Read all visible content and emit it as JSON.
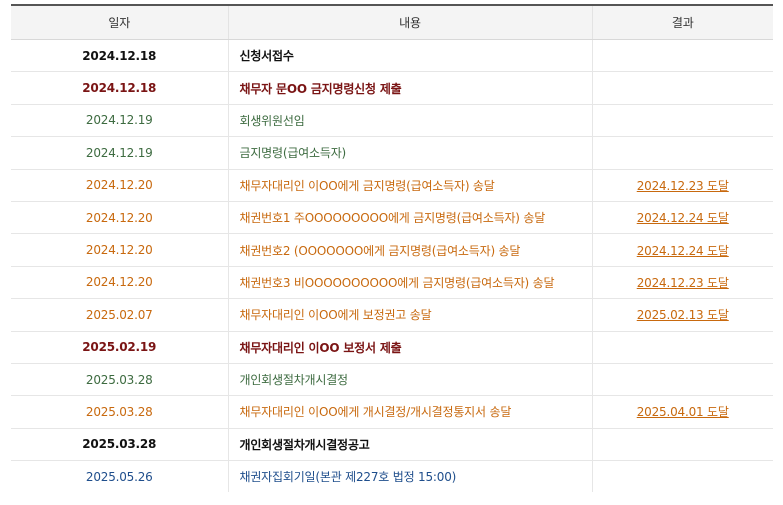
{
  "headers": {
    "date": "일자",
    "content": "내용",
    "result": "결과"
  },
  "colors": {
    "black": "#111111",
    "maroon": "#7a1414",
    "green": "#3d6b40",
    "orange": "#c8690e",
    "blue": "#1f4e8c"
  },
  "rows": [
    {
      "date": "2024.12.18",
      "content": "신청서접수",
      "result": "",
      "color": "#111111",
      "bold": true
    },
    {
      "date": "2024.12.18",
      "content": "채무자 문OO 금지명령신청 제출",
      "result": "",
      "color": "#7a1414",
      "bold": true
    },
    {
      "date": "2024.12.19",
      "content": "회생위원선임",
      "result": "",
      "color": "#3d6b40",
      "bold": false
    },
    {
      "date": "2024.12.19",
      "content": "금지명령(급여소득자)",
      "result": "",
      "color": "#3d6b40",
      "bold": false
    },
    {
      "date": "2024.12.20",
      "content": "채무자대리인 이OO에게 금지명령(급여소득자) 송달",
      "result": "2024.12.23 도달",
      "color": "#c8690e",
      "bold": false
    },
    {
      "date": "2024.12.20",
      "content": "채권번호1 주OOOOOOOOO에게 금지명령(급여소득자) 송달",
      "result": "2024.12.24 도달",
      "color": "#c8690e",
      "bold": false
    },
    {
      "date": "2024.12.20",
      "content": "채권번호2 (OOOOOOO에게 금지명령(급여소득자) 송달",
      "result": "2024.12.24 도달",
      "color": "#c8690e",
      "bold": false
    },
    {
      "date": "2024.12.20",
      "content": "채권번호3 비OOOOOOOOOO에게 금지명령(급여소득자) 송달",
      "result": "2024.12.23 도달",
      "color": "#c8690e",
      "bold": false
    },
    {
      "date": "2025.02.07",
      "content": "채무자대리인 이OO에게 보정권고 송달",
      "result": "2025.02.13 도달",
      "color": "#c8690e",
      "bold": false
    },
    {
      "date": "2025.02.19",
      "content": "채무자대리인 이OO 보정서 제출",
      "result": "",
      "color": "#7a1414",
      "bold": true
    },
    {
      "date": "2025.03.28",
      "content": "개인회생절차개시결정",
      "result": "",
      "color": "#3d6b40",
      "bold": false
    },
    {
      "date": "2025.03.28",
      "content": "채무자대리인 이OO에게 개시결정/개시결정통지서 송달",
      "result": "2025.04.01 도달",
      "color": "#c8690e",
      "bold": false
    },
    {
      "date": "2025.03.28",
      "content": "개인회생절차개시결정공고",
      "result": "",
      "color": "#111111",
      "bold": true
    },
    {
      "date": "2025.05.26",
      "content": "채권자집회기일(본관 제227호 법정 15:00)",
      "result": "",
      "color": "#1f4e8c",
      "bold": false
    }
  ]
}
